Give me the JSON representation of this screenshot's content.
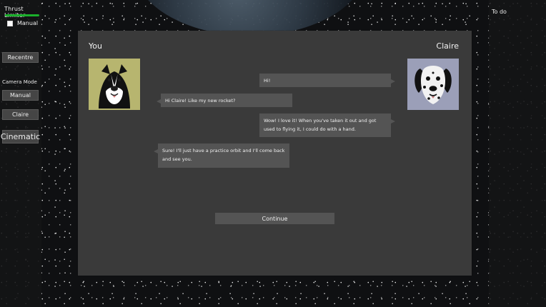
{
  "hud": {
    "thrust_limiter_label": "Thrust Limiter",
    "thrust_limit_fraction": 1,
    "manual_label": "Manual",
    "manual_checked": false,
    "recentre_label": "Recentre",
    "camera_mode_label": "Camera Mode",
    "camera_buttons": {
      "manual": "Manual",
      "claire": "Claire",
      "cinematic": "Cinematic"
    },
    "todo_label": "To do"
  },
  "dialog": {
    "you_name": "You",
    "claire_name": "Claire",
    "messages": [
      {
        "speaker": "Claire",
        "text": "Hi!"
      },
      {
        "speaker": "You",
        "text": "Hi Claire! Like my new rocket?"
      },
      {
        "speaker": "Claire",
        "text": "Wow! I love it! When you've taken it out and got used to flying it, I could do with a hand."
      },
      {
        "speaker": "You",
        "text": "Sure! I'll just have a practice orbit and I'll come back and see you."
      }
    ],
    "continue_label": "Continue"
  },
  "colors": {
    "dialog_bg": "#3a3a3a",
    "bubble_bg": "#545454",
    "thrust_green": "#1ab02b"
  },
  "icons": {
    "you_portrait": "border-collie-portrait",
    "claire_portrait": "dalmatian-portrait"
  }
}
